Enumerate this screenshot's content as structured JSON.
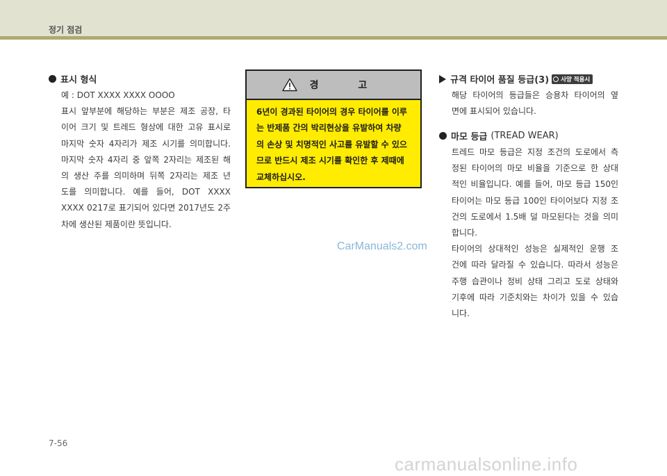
{
  "header": {
    "section_title": "정기 점검"
  },
  "left": {
    "heading": "표시 형식",
    "lines": [
      "예 : DOT XXXX XXXX OOOO",
      "표시 앞부분에 해당하는 부분은 제조 공장, 타",
      "이어 크기 및 트레드 형상에 대한 고유 표시로",
      "마지막 숫자 4자리가 제조 시기를 의미합니다.",
      "마지막 숫자 4자리 중 앞쪽 2자리는 제조된 해",
      "의 생산 주를 의미하며 뒤쪽 2자리는 제조 년",
      "도를 의미합니다. 예를 들어, DOT XXXX",
      "XXXX 0217로 표기되어 있다면 2017년도 2주",
      "차에 생산된 제품이란 뜻입니다."
    ]
  },
  "warning": {
    "title": "경 고",
    "lines": [
      "6년이 경과된 타이어의 경우 타이어를 이루",
      "는 반제품 간의 박리현상을 유발하여 차량",
      "의 손상 및 치명적인 사고를 유발할 수 있으",
      "므로 반드시 제조 시기를 확인한 후 제때에",
      "교체하십시오."
    ]
  },
  "right": {
    "heading1": "규격 타이어 품질 등급(3)",
    "badge": "사양 적용시",
    "para1": [
      "해당 타이어의 등급들은 승용차 타이어의 옆",
      "면에 표시되어 있습니다."
    ],
    "heading2": "마모 등급",
    "heading2_sub": "(TREAD WEAR)",
    "para2": [
      "트레드 마모 등급은 지정 조건의 도로에서 측",
      "정된 타이어의 마모 비율을 기준으로 한 상대",
      "적인 비율입니다. 예를 들어, 마모 등급 150인",
      "타이어는 마모 등급 100인 타이어보다 지정 조",
      "건의 도로에서 1.5배 덜 마모된다는 것을 의미",
      "합니다."
    ],
    "para3": [
      "타이어의 상대적인 성능은 실제적인 운행 조",
      "건에 따라 달라질 수 있습니다. 따라서 성능은",
      "주행 습관이나 정비 상태 그리고 도로 상태와",
      "기후에 따라 기준치와는 차이가 있을 수 있습",
      "니다."
    ]
  },
  "watermark": "CarManuals2.com",
  "page_number": "7-56",
  "bottom_watermark": "carmanualsonline.info"
}
